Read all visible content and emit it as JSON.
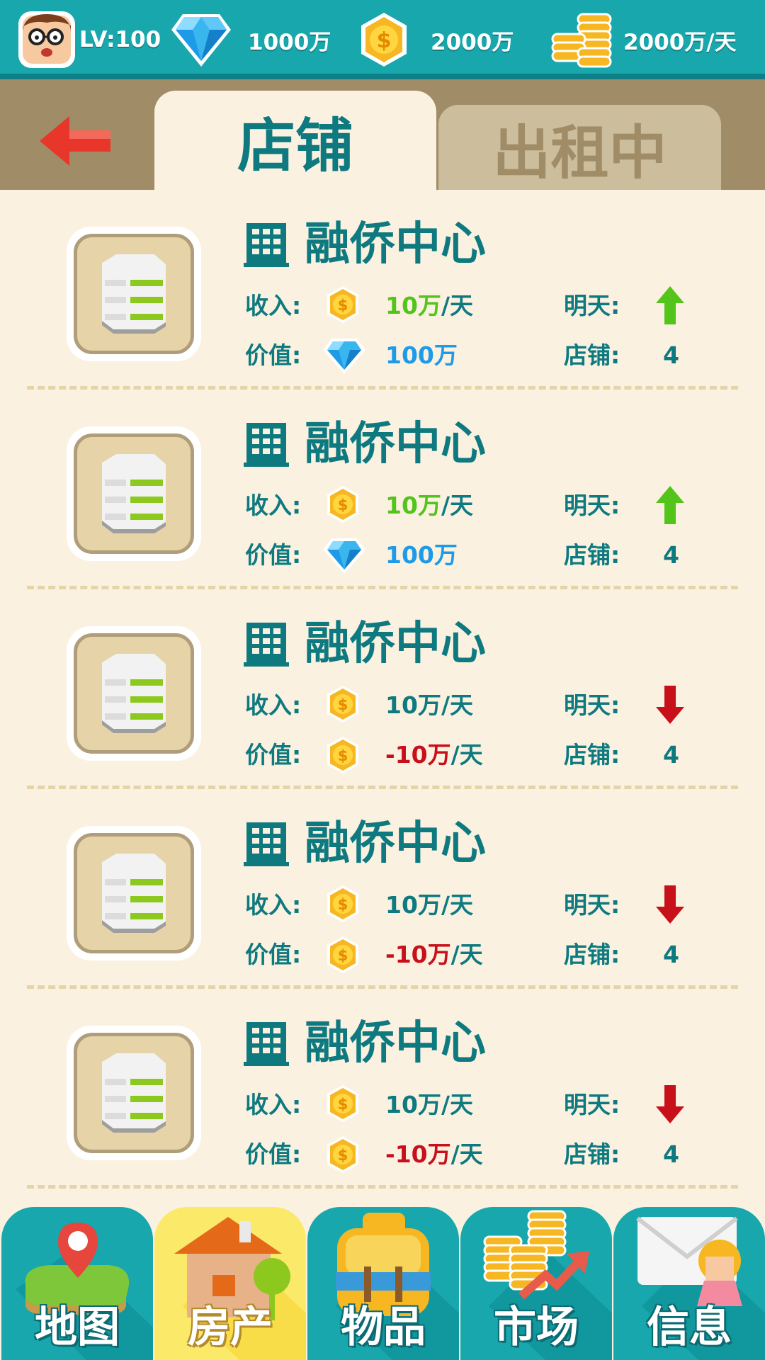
{
  "header": {
    "level": "LV:100",
    "diamonds": "1000万",
    "coins": "2000万",
    "income": "2000万/天"
  },
  "tabs": {
    "active": "店铺",
    "inactive": "出租中"
  },
  "labels": {
    "income": "收入:",
    "value": "价值:",
    "tomorrow": "明天:",
    "shops": "店铺:"
  },
  "items": [
    {
      "name": "融侨中心",
      "income_num": "10万",
      "income_unit": "/天",
      "value_num": "100万",
      "value_unit": "",
      "value_icon": "diamond-icon",
      "trend": "up",
      "shops": "4"
    },
    {
      "name": "融侨中心",
      "income_num": "10万",
      "income_unit": "/天",
      "value_num": "100万",
      "value_unit": "",
      "value_icon": "diamond-icon",
      "trend": "up",
      "shops": "4"
    },
    {
      "name": "融侨中心",
      "income_num": "10万",
      "income_unit": "/天",
      "value_num": "-10万",
      "value_unit": "/天",
      "value_icon": "coin-icon",
      "trend": "down",
      "shops": "4"
    },
    {
      "name": "融侨中心",
      "income_num": "10万",
      "income_unit": "/天",
      "value_num": "-10万",
      "value_unit": "/天",
      "value_icon": "coin-icon",
      "trend": "down",
      "shops": "4"
    },
    {
      "name": "融侨中心",
      "income_num": "10万",
      "income_unit": "/天",
      "value_num": "-10万",
      "value_unit": "/天",
      "value_icon": "coin-icon",
      "trend": "down",
      "shops": "4"
    }
  ],
  "nav": {
    "map": "地图",
    "property": "房产",
    "items": "物品",
    "market": "市场",
    "info": "信息"
  },
  "colors": {
    "teal": "#17a7ad",
    "up_green": "#52c41a",
    "down_red": "#c8101b",
    "diamond_blue": "#1e9be8"
  }
}
